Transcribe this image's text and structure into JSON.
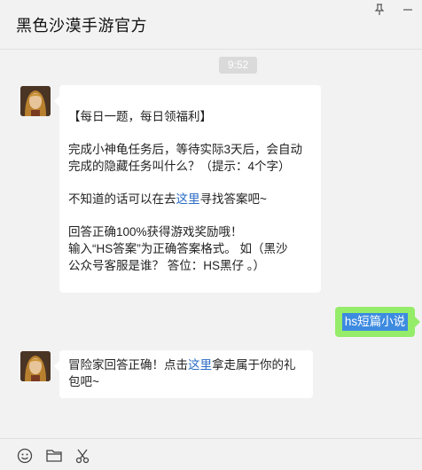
{
  "window": {
    "title": "黑色沙漠手游官方",
    "pin_icon": "pin-icon",
    "minimize_icon": "minimize-icon"
  },
  "time": "9:52",
  "messages": [
    {
      "sender": "official",
      "avatar_icon": "character-avatar",
      "header": "【每日一题，每日领福利】",
      "question_l1": "完成小神龟任务后，等待实际3天后，会自动",
      "question_l2": "完成的隐藏任务叫什么？（提示：4个字）",
      "hint_pre": "不知道的话可以在去",
      "hint_link": "这里",
      "hint_post": "寻找答案吧~",
      "reward_l1": "回答正确100%获得游戏奖励哦！",
      "reward_l2": "输入“HS答案”为正确答案格式。 如（黑沙",
      "reward_l3": "公众号客服是谁？ 答位：HS黑仔 。）"
    },
    {
      "sender": "self",
      "text": "hs短篇小说"
    },
    {
      "sender": "official",
      "avatar_icon": "character-avatar",
      "text_pre": "冒险家回答正确！点击",
      "link": "这里",
      "text_post": "拿走属于你的礼",
      "text_l2": "包吧~"
    }
  ],
  "toolbar": {
    "icons": [
      "emoji-icon",
      "folder-icon",
      "scissors-icon"
    ]
  },
  "colors": {
    "self_bubble": "#95ec69",
    "link": "#2b6cc4",
    "selection": "#3d8be0",
    "background": "#f2f2f2"
  }
}
